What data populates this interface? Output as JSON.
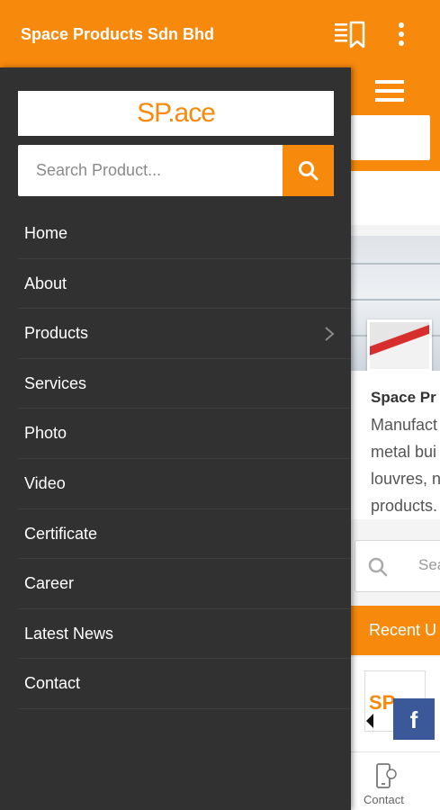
{
  "appbar": {
    "title": "Space Products Sdn Bhd",
    "bookmark_icon": "bookmark-list-icon",
    "more_icon": "more-vertical-icon"
  },
  "drawer": {
    "logo_text": "SP.ace",
    "search": {
      "placeholder": "Search Product...",
      "button_icon": "search-icon"
    },
    "menu": [
      {
        "label": "Home"
      },
      {
        "label": "About"
      },
      {
        "label": "Products",
        "has_submenu": true
      },
      {
        "label": "Services"
      },
      {
        "label": "Photo"
      },
      {
        "label": "Video"
      },
      {
        "label": "Certificate"
      },
      {
        "label": "Career"
      },
      {
        "label": "Latest News"
      },
      {
        "label": "Contact"
      }
    ]
  },
  "background": {
    "company_title": "Space Pr",
    "description_lines": [
      "Manufact",
      "metal bui",
      "louvres, n",
      "products."
    ],
    "search_placeholder": "Sea",
    "recent_label": "Recent U",
    "card_logo": "SP",
    "fb_label": "f",
    "bottom_nav_contact": "Contact"
  },
  "colors": {
    "accent": "#f7890c",
    "drawer_bg": "#313131",
    "facebook": "#3b5998"
  }
}
